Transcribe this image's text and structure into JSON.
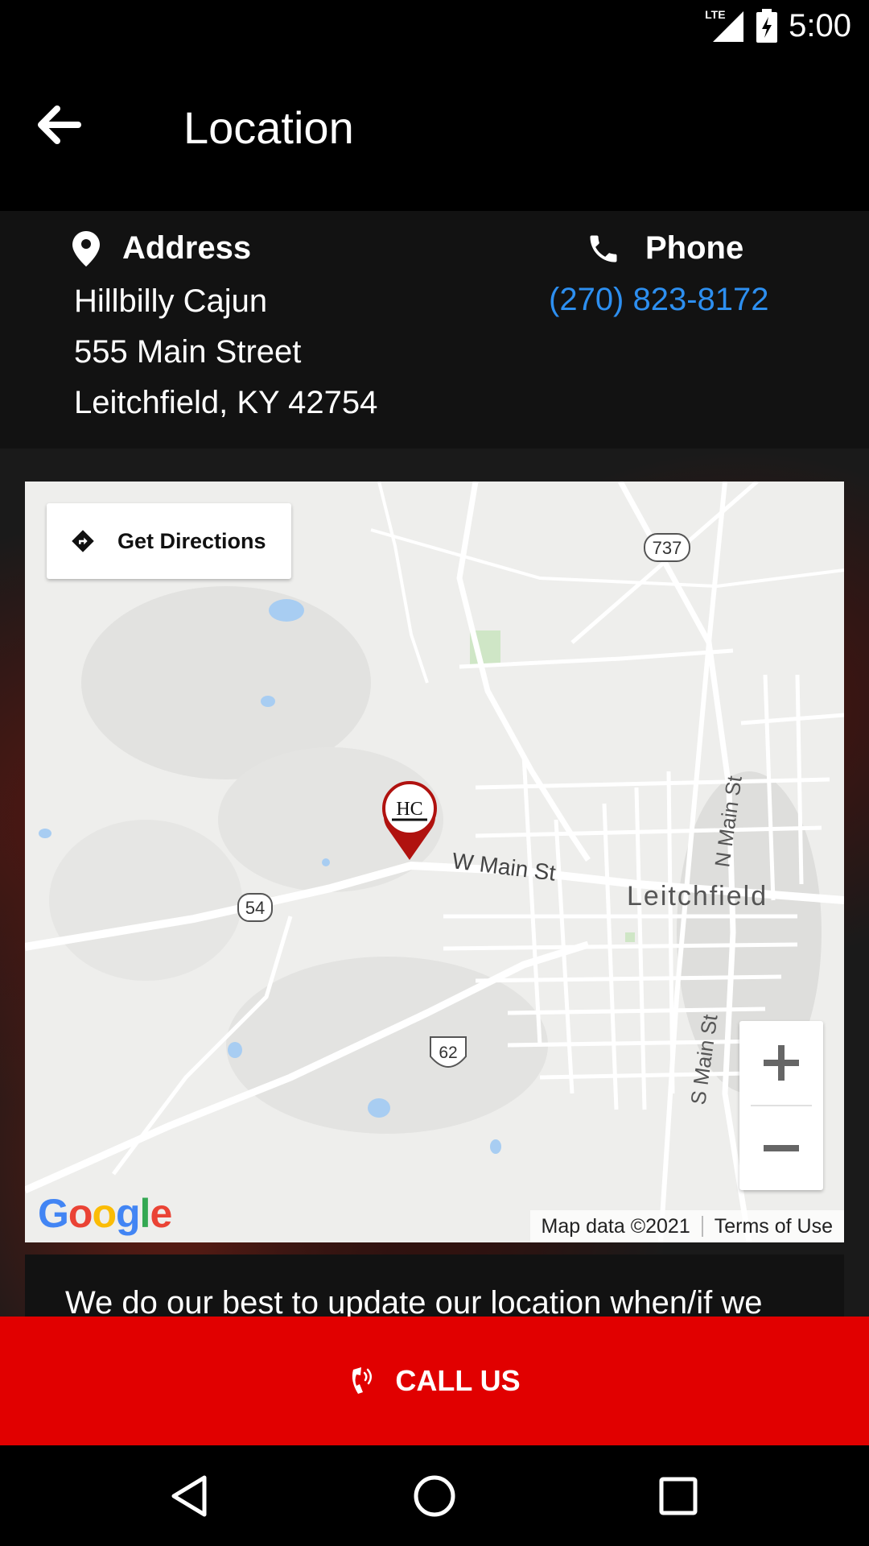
{
  "status_bar": {
    "time": "5:00",
    "network": "LTE",
    "icons": [
      "lte-signal-icon",
      "battery-charging-icon"
    ]
  },
  "app_bar": {
    "title": "Location",
    "back_icon": "arrow-left-icon"
  },
  "address": {
    "heading": "Address",
    "icon": "map-pin-icon",
    "lines": [
      "Hillbilly Cajun",
      "555 Main Street",
      "Leitchfield, KY 42754"
    ]
  },
  "phone": {
    "heading": "Phone",
    "icon": "phone-icon",
    "number": "(270) 823-8172",
    "color": "#2d8ff0"
  },
  "map": {
    "directions_label": "Get Directions",
    "directions_icon": "directions-diamond-icon",
    "labels": {
      "w_main_st": "W Main St",
      "town": "Leitchfield",
      "n_main_st": "N Main St",
      "s_main_st": "S Main St",
      "route_737": "737",
      "route_54": "54",
      "route_62": "62"
    },
    "marker_text": "HC",
    "google_logo": "Google",
    "attribution": "Map data ©2021",
    "terms": "Terms of Use",
    "zoom_in_icon": "plus-icon",
    "zoom_out_icon": "minus-icon"
  },
  "notice": {
    "text": "We do our best to update our location when/if we"
  },
  "call_bar": {
    "label": "CALL US",
    "icon": "phone-ringing-icon",
    "color": "#e10000"
  },
  "nav_bar": {
    "icons": [
      "nav-back-icon",
      "nav-home-icon",
      "nav-recents-icon"
    ]
  }
}
